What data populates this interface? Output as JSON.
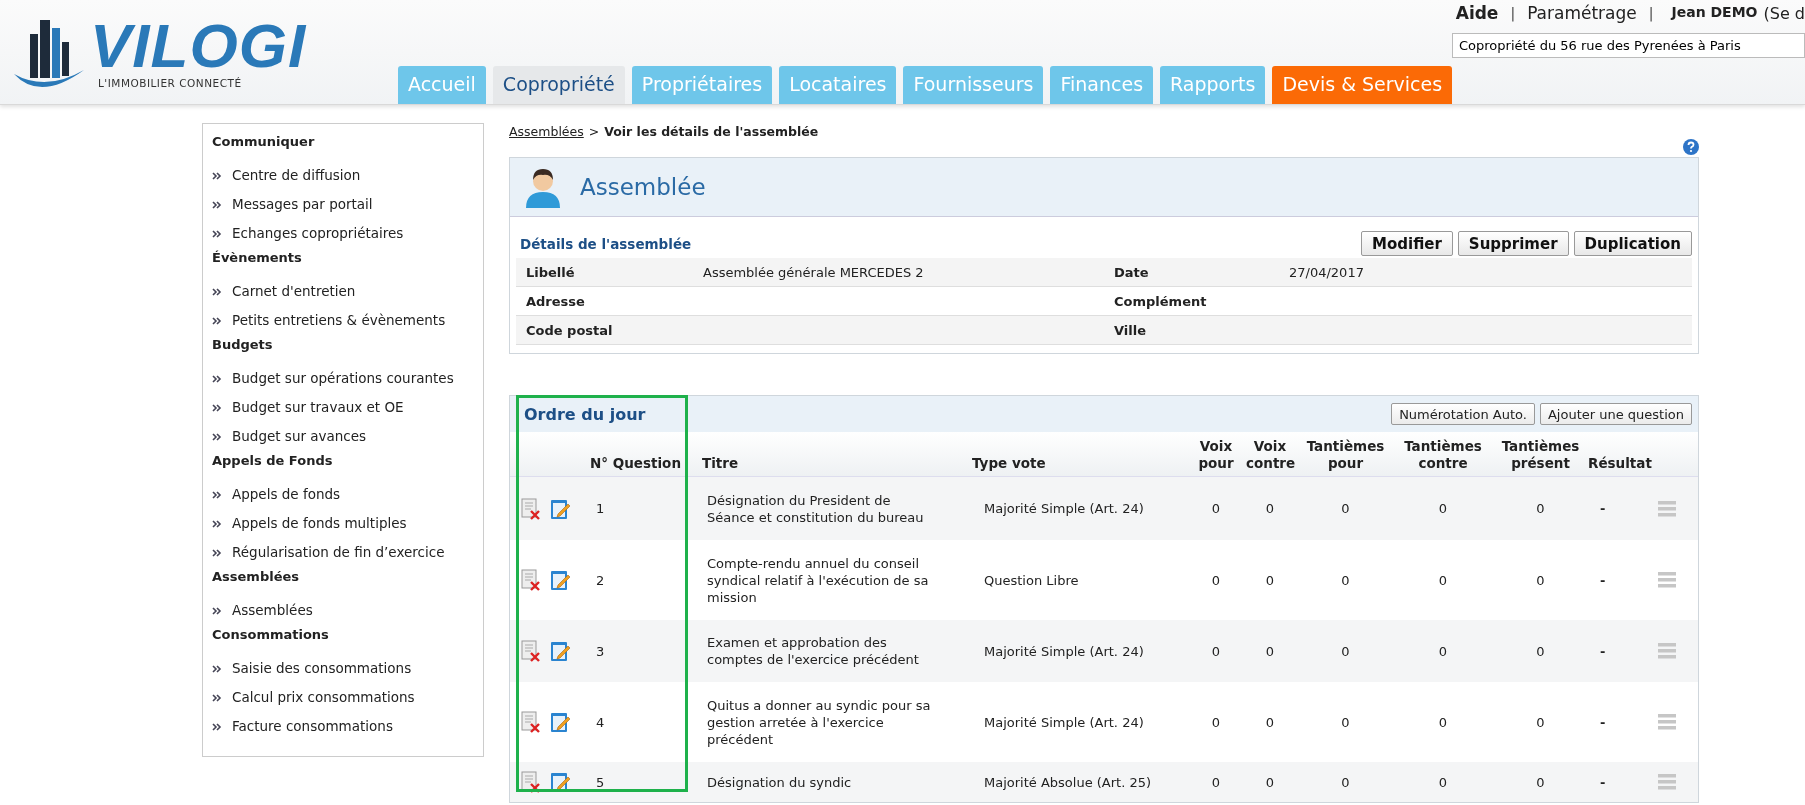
{
  "header": {
    "logo": {
      "name": "VILOGI",
      "tagline": "L'IMMOBILIER CONNECTÉ"
    },
    "top_links": [
      "Aide",
      "Paramétrage"
    ],
    "link_separator": "|",
    "user": "Jean DEMO",
    "logout": "(Se d",
    "property_selector": {
      "value": "Copropriété du 56 rue des Pyrenées à Paris"
    },
    "tabs": [
      {
        "label": "Accueil",
        "selected": false,
        "kind": "normal"
      },
      {
        "label": "Copropriété",
        "selected": true,
        "kind": "normal"
      },
      {
        "label": "Propriétaires",
        "selected": false,
        "kind": "normal"
      },
      {
        "label": "Locataires",
        "selected": false,
        "kind": "normal"
      },
      {
        "label": "Fournisseurs",
        "selected": false,
        "kind": "normal"
      },
      {
        "label": "Finances",
        "selected": false,
        "kind": "normal"
      },
      {
        "label": "Rapports",
        "selected": false,
        "kind": "normal"
      },
      {
        "label": "Devis & Services",
        "selected": false,
        "kind": "promo"
      }
    ]
  },
  "sidebar": {
    "sections": [
      {
        "title": "Communiquer",
        "items": [
          "Centre de diffusion",
          "Messages par portail",
          "Echanges copropriétaires"
        ]
      },
      {
        "title": "Évènements",
        "items": [
          "Carnet d'entretien",
          "Petits entretiens & évènements"
        ]
      },
      {
        "title": "Budgets",
        "items": [
          "Budget sur opérations courantes",
          "Budget sur travaux et OE",
          "Budget sur avances"
        ]
      },
      {
        "title": "Appels de Fonds",
        "items": [
          "Appels de fonds",
          "Appels de fonds multiples",
          "Régularisation de fin d’exercice"
        ]
      },
      {
        "title": "Assemblées",
        "items": [
          "Assemblées"
        ]
      },
      {
        "title": "Consommations",
        "items": [
          "Saisie des consommations",
          "Calcul prix consommations",
          "Facture consommations"
        ]
      }
    ]
  },
  "breadcrumb": {
    "link": "Assemblées",
    "separator": ">",
    "current": "Voir les détails de l'assemblée"
  },
  "assembly": {
    "title": "Assemblée",
    "section_title": "Détails de l'assemblée",
    "buttons": [
      "Modifier",
      "Supprimer",
      "Duplication"
    ],
    "fields": [
      [
        {
          "label": "Libellé",
          "value": "Assemblée générale MERCEDES 2"
        },
        {
          "label": "Date",
          "value": "27/04/2017"
        }
      ],
      [
        {
          "label": "Adresse"
        },
        {
          "label": "Complément"
        }
      ],
      [
        {
          "label": "Code postal"
        },
        {
          "label": "Ville"
        }
      ]
    ]
  },
  "agenda": {
    "title": "Ordre du jour",
    "buttons": [
      "Numérotation Auto.",
      "Ajouter une question"
    ],
    "columns": [
      "N° Question",
      "Titre",
      "Type vote",
      "Voix pour",
      "Voix contre",
      "Tantièmes pour",
      "Tantièmes contre",
      "Tantièmes présent",
      "Résultat"
    ],
    "rows": [
      {
        "number": "1",
        "title": "Désignation du President de Séance et constitution du bureau",
        "vote_type": "Majorité Simple (Art. 24)",
        "values": [
          "0",
          "0",
          "0",
          "0",
          "0"
        ],
        "result": "-"
      },
      {
        "number": "2",
        "title": "Compte-rendu annuel du conseil syndical relatif à l'exécution de sa mission",
        "vote_type": "Question Libre",
        "values": [
          "0",
          "0",
          "0",
          "0",
          "0"
        ],
        "result": "-"
      },
      {
        "number": "3",
        "title": "Examen et approbation des comptes de l'exercice précédent",
        "vote_type": "Majorité Simple (Art. 24)",
        "values": [
          "0",
          "0",
          "0",
          "0",
          "0"
        ],
        "result": "-"
      },
      {
        "number": "4",
        "title": "Quitus a donner au syndic pour sa gestion arretée à l'exercice précédent",
        "vote_type": "Majorité Simple (Art. 24)",
        "values": [
          "0",
          "0",
          "0",
          "0",
          "0"
        ],
        "result": "-"
      },
      {
        "number": "5",
        "title": "Désignation du syndic",
        "vote_type": "Majorité Absolue (Art. 25)",
        "values": [
          "0",
          "0",
          "0",
          "0",
          "0"
        ],
        "result": "-"
      }
    ]
  }
}
